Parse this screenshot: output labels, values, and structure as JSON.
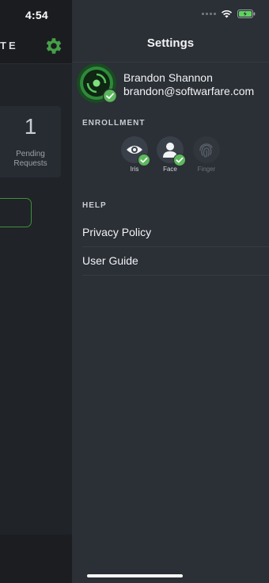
{
  "status_bar": {
    "time": "4:54"
  },
  "background": {
    "logo_fragment": "TE",
    "pending_count": "1",
    "pending_label_line1": "Pending",
    "pending_label_line2": "Requests",
    "accent_color": "#3e8f3e"
  },
  "settings": {
    "title": "Settings",
    "profile": {
      "name": "Brandon Shannon",
      "email": "brandon@softwarfare.com",
      "verified": true
    },
    "enrollment": {
      "header": "ENROLLMENT",
      "items": [
        {
          "label": "Iris",
          "icon": "eye-icon",
          "enrolled": true
        },
        {
          "label": "Face",
          "icon": "person-icon",
          "enrolled": true
        },
        {
          "label": "Finger",
          "icon": "fingerprint-icon",
          "enrolled": false
        }
      ]
    },
    "help": {
      "header": "HELP",
      "items": [
        {
          "label": "Privacy Policy"
        },
        {
          "label": "User Guide"
        }
      ]
    }
  },
  "colors": {
    "check_green": "#5cb85c",
    "drawer_bg": "#2b2f36",
    "background_bg": "#202328"
  }
}
